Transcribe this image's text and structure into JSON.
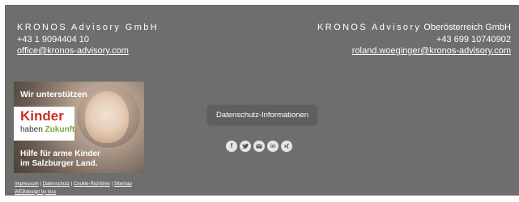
{
  "left": {
    "company": "KRONOS Advisory GmbH",
    "phone": "+43 1 9094404 10",
    "email": "office@kronos-advisory.com"
  },
  "right": {
    "company_prefix": "KRONOS Advisory",
    "company_suffix": "Oberösterreich GmbH",
    "phone": "+43 699 10740902",
    "email": "roland.woeginger@kronos-advisory.com"
  },
  "banner": {
    "top": "Wir unterstützen",
    "kinder": "Kinder",
    "haben": "haben",
    "zukunft": "Zukunft.",
    "hilfe_line1": "Hilfe für arme Kinder",
    "hilfe_line2": "im Salzburger Land."
  },
  "legal": {
    "impressum": "Impressum",
    "datenschutz": "Datenschutz",
    "cookie": "Cookie-Richtlinie",
    "sitemap": "Sitemap",
    "separator": "|",
    "webdesign": "WEBdesign by kiss"
  },
  "privacy_button": "Datenschutz-Informationen",
  "social": [
    {
      "name": "facebook-icon",
      "glyph": "f"
    },
    {
      "name": "twitter-icon",
      "glyph": ""
    },
    {
      "name": "email-icon",
      "glyph": ""
    },
    {
      "name": "linkedin-icon",
      "glyph": "in"
    },
    {
      "name": "xing-icon",
      "glyph": ""
    }
  ],
  "colors": {
    "footer_bg": "#6e6e6c",
    "accent_red": "#c9302c",
    "accent_green": "#7aa63a"
  }
}
